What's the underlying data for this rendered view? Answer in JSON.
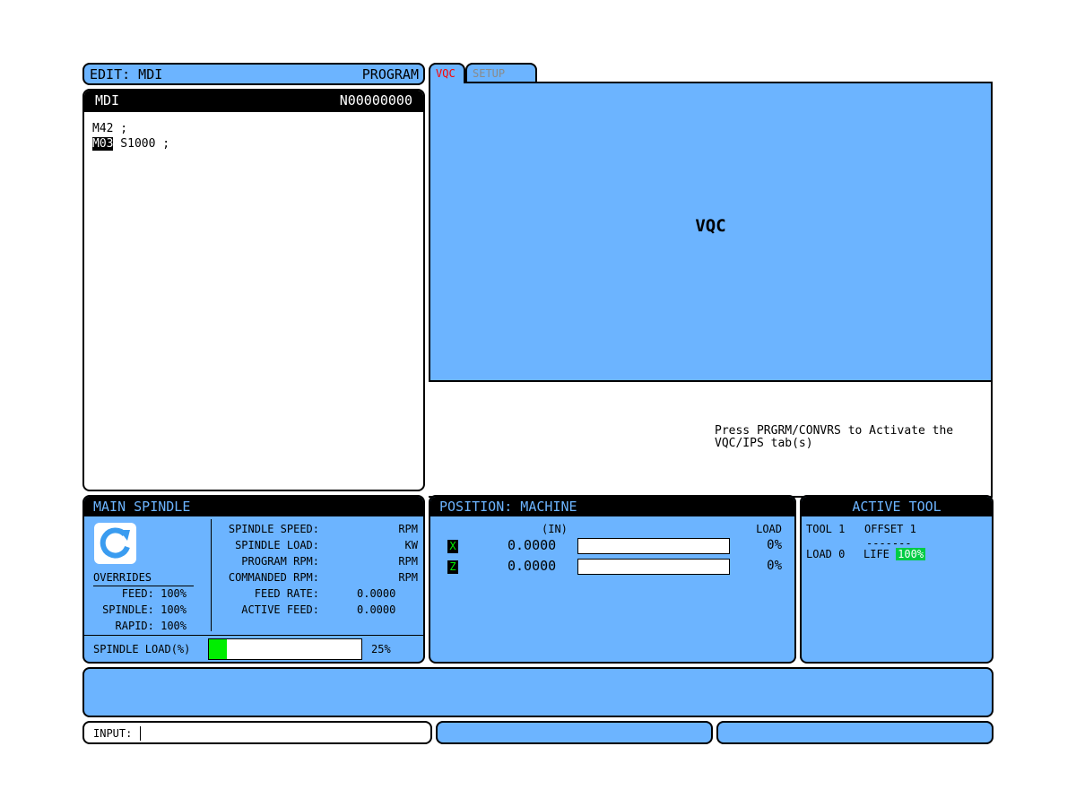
{
  "edit_header": {
    "mode": "EDIT:  MDI",
    "section": "PROGRAM"
  },
  "mdi": {
    "title": "MDI",
    "sequence": "N00000000",
    "lines": [
      {
        "prefix": "",
        "cursor": "",
        "text": "M42 ;"
      },
      {
        "prefix": "",
        "cursor": "M03",
        "text": " S1000 ;"
      }
    ]
  },
  "tabs": [
    {
      "label": "VQC",
      "active": true,
      "color": "#ff0000"
    },
    {
      "label": "SETUP",
      "active": false,
      "color": "#8a8a8a"
    }
  ],
  "vqc": {
    "label": "VQC",
    "message": "Press PRGRM/CONVRS to Activate the\nVQC/IPS tab(s)"
  },
  "main_spindle": {
    "title": "MAIN SPINDLE",
    "icon": "rotate-cw-icon",
    "overrides_label": "OVERRIDES",
    "overrides": [
      {
        "label": "FEED: 100%"
      },
      {
        "label": "SPINDLE: 100%"
      },
      {
        "label": "RAPID: 100%"
      }
    ],
    "readouts": [
      {
        "label": "SPINDLE SPEED:",
        "value": "",
        "unit": "RPM"
      },
      {
        "label": "SPINDLE LOAD:",
        "value": "",
        "unit": "KW"
      },
      {
        "label": "PROGRAM RPM:",
        "value": "",
        "unit": "RPM"
      },
      {
        "label": "COMMANDED RPM:",
        "value": "",
        "unit": "RPM"
      },
      {
        "label": "FEED RATE:",
        "value": "0.0000",
        "unit": ""
      },
      {
        "label": "ACTIVE FEED:",
        "value": "0.0000",
        "unit": ""
      }
    ],
    "load_label": "SPINDLE LOAD(%)",
    "load_percent": 12,
    "load_text": "25%",
    "load_color": "#00ee00"
  },
  "position": {
    "title": "POSITION:  MACHINE",
    "units": "(IN)",
    "load_header": "LOAD",
    "axes": [
      {
        "name": "X",
        "value": "0.0000",
        "load": "0%"
      },
      {
        "name": "Z",
        "value": "0.0000",
        "load": "0%"
      }
    ]
  },
  "active_tool": {
    "title": "ACTIVE TOOL",
    "tool": "TOOL 1",
    "offset": "OFFSET 1",
    "dashes": "-------",
    "load": "LOAD 0",
    "life_label": "LIFE",
    "life_value": "100%"
  },
  "input": {
    "label": "INPUT:",
    "value": ""
  },
  "colors": {
    "panel_blue": "#6cb4ff",
    "highlight_green": "#00ee00",
    "tab_active": "#ff0000"
  }
}
